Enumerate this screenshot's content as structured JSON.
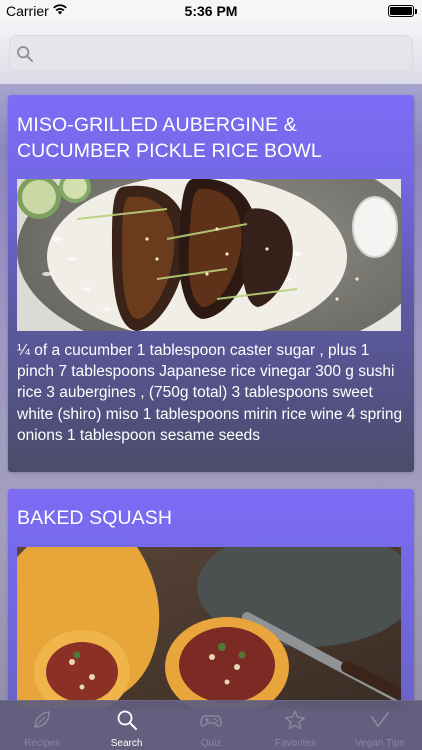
{
  "status_bar": {
    "carrier": "Carrier",
    "time": "5:36 PM"
  },
  "search": {
    "value": "",
    "placeholder": ""
  },
  "recipes": [
    {
      "title": "MISO-GRILLED AUBERGINE & CUCUMBER PICKLE RICE BOWL",
      "image": "miso-aubergine-rice-bowl-photo",
      "ingredients": "¼ of a cucumber  1 tablespoon caster sugar , plus 1 pinch  7 tablespoons Japanese rice vinegar  300 g sushi rice  3 aubergines , (750g total)  3 tablespoons sweet white (shiro) miso  1 tablespoons mirin rice wine  4 spring onions  1 tablespoon sesame seeds"
    },
    {
      "title": "BAKED SQUASH",
      "image": "baked-squash-photo"
    }
  ],
  "tab_bar": {
    "active": "Search",
    "tabs": [
      {
        "label": "Recipes",
        "icon": "leaf-icon"
      },
      {
        "label": "Search",
        "icon": "search-icon"
      },
      {
        "label": "Quiz",
        "icon": "gamepad-icon"
      },
      {
        "label": "Favorites",
        "icon": "star-icon"
      },
      {
        "label": "Vegan Tips",
        "icon": "check-icon"
      }
    ]
  },
  "colors": {
    "card_top": "#7e6cf5",
    "card_bottom": "#4b4b6a",
    "tab_bar": "#605c7c",
    "tab_active": "#ffffff",
    "tab_inactive": "#8a87a0"
  }
}
